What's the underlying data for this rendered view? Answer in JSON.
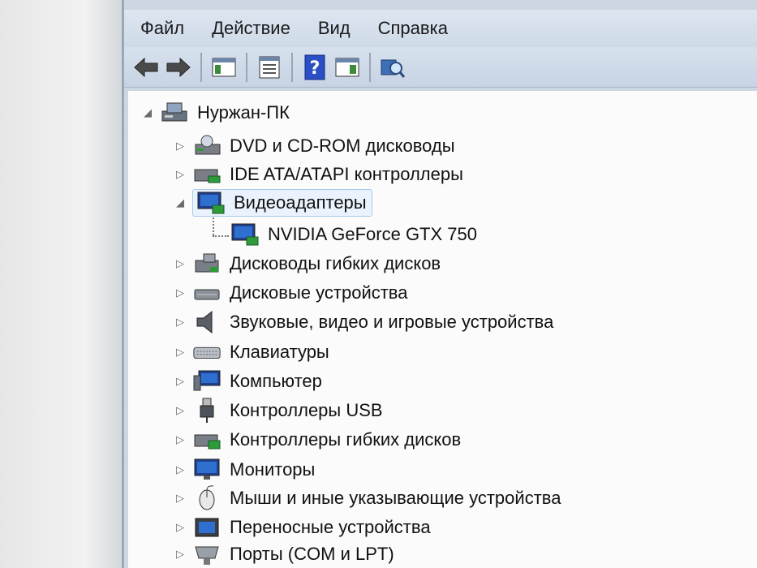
{
  "menu": {
    "file": "Файл",
    "action": "Действие",
    "view": "Вид",
    "help": "Справка"
  },
  "toolbar": {
    "buttons": [
      "back-icon",
      "forward-icon",
      "console-tree-icon",
      "properties-icon",
      "help-icon",
      "action-pane-icon",
      "scan-hardware-icon"
    ]
  },
  "tree": {
    "root": "Нуржан-ПК",
    "items": [
      {
        "label": "DVD и CD-ROM дисководы",
        "icon": "dvd-drive-icon",
        "expanded": false
      },
      {
        "label": "IDE ATA/ATAPI контроллеры",
        "icon": "ide-controller-icon",
        "expanded": false
      },
      {
        "label": "Видеоадаптеры",
        "icon": "display-adapter-icon",
        "expanded": true,
        "selected": true
      },
      {
        "label": "NVIDIA GeForce GTX 750",
        "icon": "display-adapter-icon",
        "child": true
      },
      {
        "label": "Дисководы гибких дисков",
        "icon": "floppy-drive-icon",
        "expanded": false
      },
      {
        "label": "Дисковые устройства",
        "icon": "disk-drive-icon",
        "expanded": false
      },
      {
        "label": "Звуковые, видео и игровые устройства",
        "icon": "speaker-icon",
        "expanded": false
      },
      {
        "label": "Клавиатуры",
        "icon": "keyboard-icon",
        "expanded": false
      },
      {
        "label": "Компьютер",
        "icon": "computer-icon",
        "expanded": false
      },
      {
        "label": "Контроллеры USB",
        "icon": "usb-icon",
        "expanded": false
      },
      {
        "label": "Контроллеры гибких дисков",
        "icon": "floppy-controller-icon",
        "expanded": false
      },
      {
        "label": "Мониторы",
        "icon": "monitor-icon",
        "expanded": false
      },
      {
        "label": "Мыши и иные указывающие устройства",
        "icon": "mouse-icon",
        "expanded": false
      },
      {
        "label": "Переносные устройства",
        "icon": "portable-device-icon",
        "expanded": false
      },
      {
        "label": "Порты (COM и LPT)",
        "icon": "port-icon",
        "expanded": false
      }
    ]
  },
  "colors": {
    "selection_bg": "#eaf3fd",
    "selection_border": "#a9c8ec",
    "frame": "#cdd7e3",
    "tree_bg": "#fbfbfb"
  }
}
